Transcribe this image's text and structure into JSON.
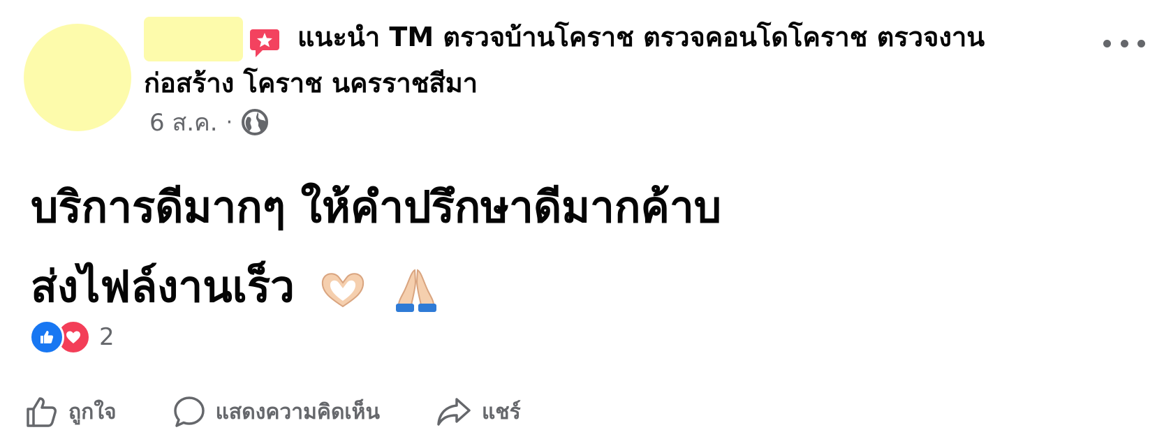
{
  "post": {
    "header_text": "แนะนำ TM ตรวจบ้านโคราช ตรวจคอนโดโคราช ตรวจงานก่อสร้าง โคราช นครราชสีมา",
    "date": "6 ส.ค.",
    "separator": "·",
    "privacy_icon": "globe-icon",
    "recommend_icon": "recommend-star-icon",
    "content_line1": "บริการดีมากๆ ให้คำปรึกษาดีมากค้าบ",
    "content_line2": "ส่งไฟล์งานเร็ว"
  },
  "reactions": {
    "types": [
      "like-icon",
      "love-icon"
    ],
    "count": "2"
  },
  "actions": {
    "like_label": "ถูกใจ",
    "comment_label": "แสดงความคิดเห็น",
    "share_label": "แชร์"
  },
  "colors": {
    "accent_blue": "#1877f2",
    "love_red": "#f33e58",
    "recommend_pink": "#f3425f",
    "secondary_text": "#65676b",
    "redaction_yellow": "#fdfbab"
  }
}
